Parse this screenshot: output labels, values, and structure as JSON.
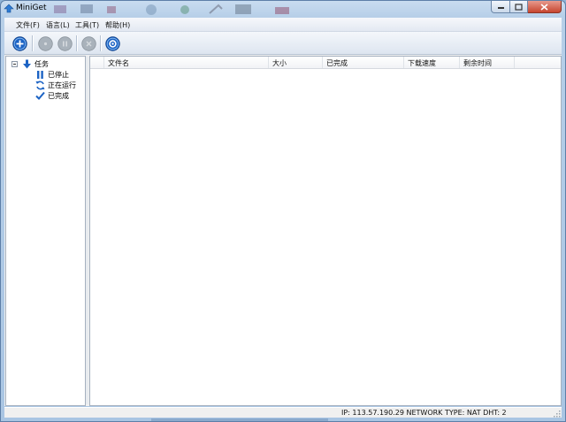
{
  "window": {
    "title": "MiniGet"
  },
  "menu": {
    "file": "文件(F)",
    "language": "语言(L)",
    "tools": "工具(T)",
    "help": "帮助(H)"
  },
  "toolbar": {
    "buttons": [
      {
        "icon": "plus-icon",
        "state": "enabled"
      },
      {
        "icon": "play-icon",
        "state": "disabled"
      },
      {
        "icon": "pause-icon",
        "state": "disabled"
      },
      {
        "icon": "stop-icon",
        "state": "disabled"
      },
      {
        "icon": "gear-icon",
        "state": "enabled"
      }
    ]
  },
  "tree": {
    "root": {
      "label": "任务",
      "icon": "down-arrow-icon"
    },
    "children": [
      {
        "label": "已停止",
        "icon": "pause-icon"
      },
      {
        "label": "正在运行",
        "icon": "refresh-icon"
      },
      {
        "label": "已完成",
        "icon": "check-icon"
      }
    ]
  },
  "list": {
    "columns": [
      "文件名",
      "大小",
      "已完成",
      "下载速度",
      "剩余时间"
    ],
    "rows": []
  },
  "status": {
    "text": "IP: 113.57.190.29 NETWORK TYPE: NAT   DHT: 2"
  },
  "colors": {
    "accent": "#1c63c4",
    "disabled": "#9aa4ae",
    "frame": "#a9c5e3"
  }
}
